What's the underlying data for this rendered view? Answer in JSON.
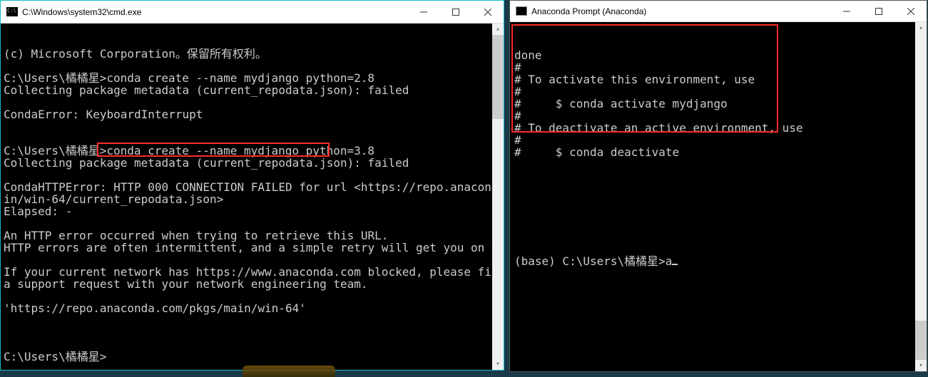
{
  "left": {
    "title": "C:\\Windows\\system32\\cmd.exe",
    "lines": [
      "(c) Microsoft Corporation。保留所有权利。",
      "",
      "C:\\Users\\橘橘星>conda create --name mydjango python=2.8",
      "Collecting package metadata (current_repodata.json): failed",
      "",
      "CondaError: KeyboardInterrupt",
      "",
      "",
      "C:\\Users\\橘橘星>conda create --name mydjango python=3.8",
      "Collecting package metadata (current_repodata.json): failed",
      "",
      "CondaHTTPError: HTTP 000 CONNECTION FAILED for url <https://repo.anaconda.com/pkgs/ma",
      "in/win-64/current_repodata.json>",
      "Elapsed: -",
      "",
      "An HTTP error occurred when trying to retrieve this URL.",
      "HTTP errors are often intermittent, and a simple retry will get you on your way.",
      "",
      "If your current network has https://www.anaconda.com blocked, please file",
      "a support request with your network engineering team.",
      "",
      "'https://repo.anaconda.com/pkgs/main/win-64'",
      "",
      "",
      "",
      "C:\\Users\\橘橘星>"
    ],
    "highlight_command": "conda create --name mydjango python=3.8"
  },
  "right": {
    "title": "Anaconda Prompt (Anaconda)",
    "highlighted_lines": [
      "done",
      "#",
      "# To activate this environment, use",
      "#",
      "#     $ conda activate mydjango",
      "#",
      "# To deactivate an active environment, use",
      "#",
      "#     $ conda deactivate"
    ],
    "prompt_line": "(base) C:\\Users\\橘橘星>a"
  },
  "winbtn": {
    "min": "minimize",
    "max": "maximize",
    "close": "close"
  }
}
